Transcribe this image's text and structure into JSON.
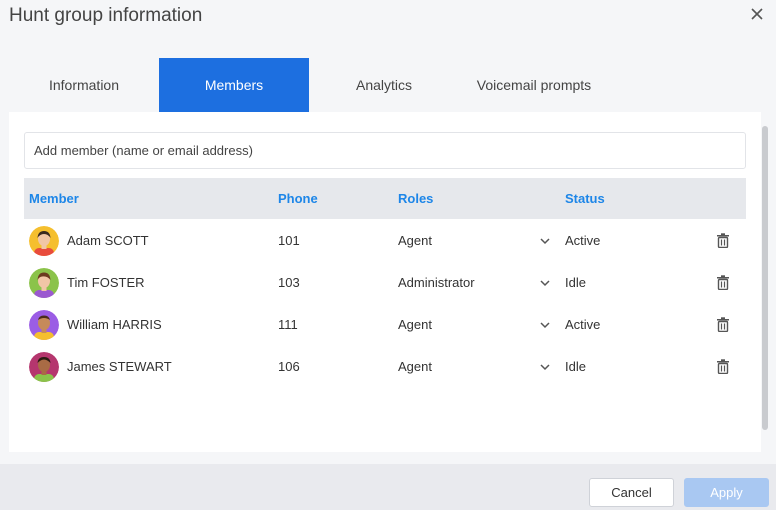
{
  "dialog": {
    "title": "Hunt group information"
  },
  "tabs": [
    {
      "label": "Information",
      "active": false
    },
    {
      "label": "Members",
      "active": true
    },
    {
      "label": "Analytics",
      "active": false
    },
    {
      "label": "Voicemail prompts",
      "active": false
    }
  ],
  "add_member": {
    "placeholder": "Add member (name or email address)",
    "value": ""
  },
  "table": {
    "headers": {
      "member": "Member",
      "phone": "Phone",
      "roles": "Roles",
      "status": "Status"
    },
    "rows": [
      {
        "name": "Adam SCOTT",
        "phone": "101",
        "role": "Agent",
        "status": "Active"
      },
      {
        "name": "Tim FOSTER",
        "phone": "103",
        "role": "Administrator",
        "status": "Idle"
      },
      {
        "name": "William HARRIS",
        "phone": "111",
        "role": "Agent",
        "status": "Active"
      },
      {
        "name": "James STEWART",
        "phone": "106",
        "role": "Agent",
        "status": "Idle"
      }
    ]
  },
  "footer": {
    "cancel_label": "Cancel",
    "apply_label": "Apply"
  },
  "colors": {
    "accent": "#1d6fe0",
    "header_text": "#1d86e8",
    "apply_disabled": "#a9c8f2"
  },
  "icons": {
    "close": "close-icon",
    "chevron": "chevron-down-icon",
    "delete": "trash-icon"
  }
}
